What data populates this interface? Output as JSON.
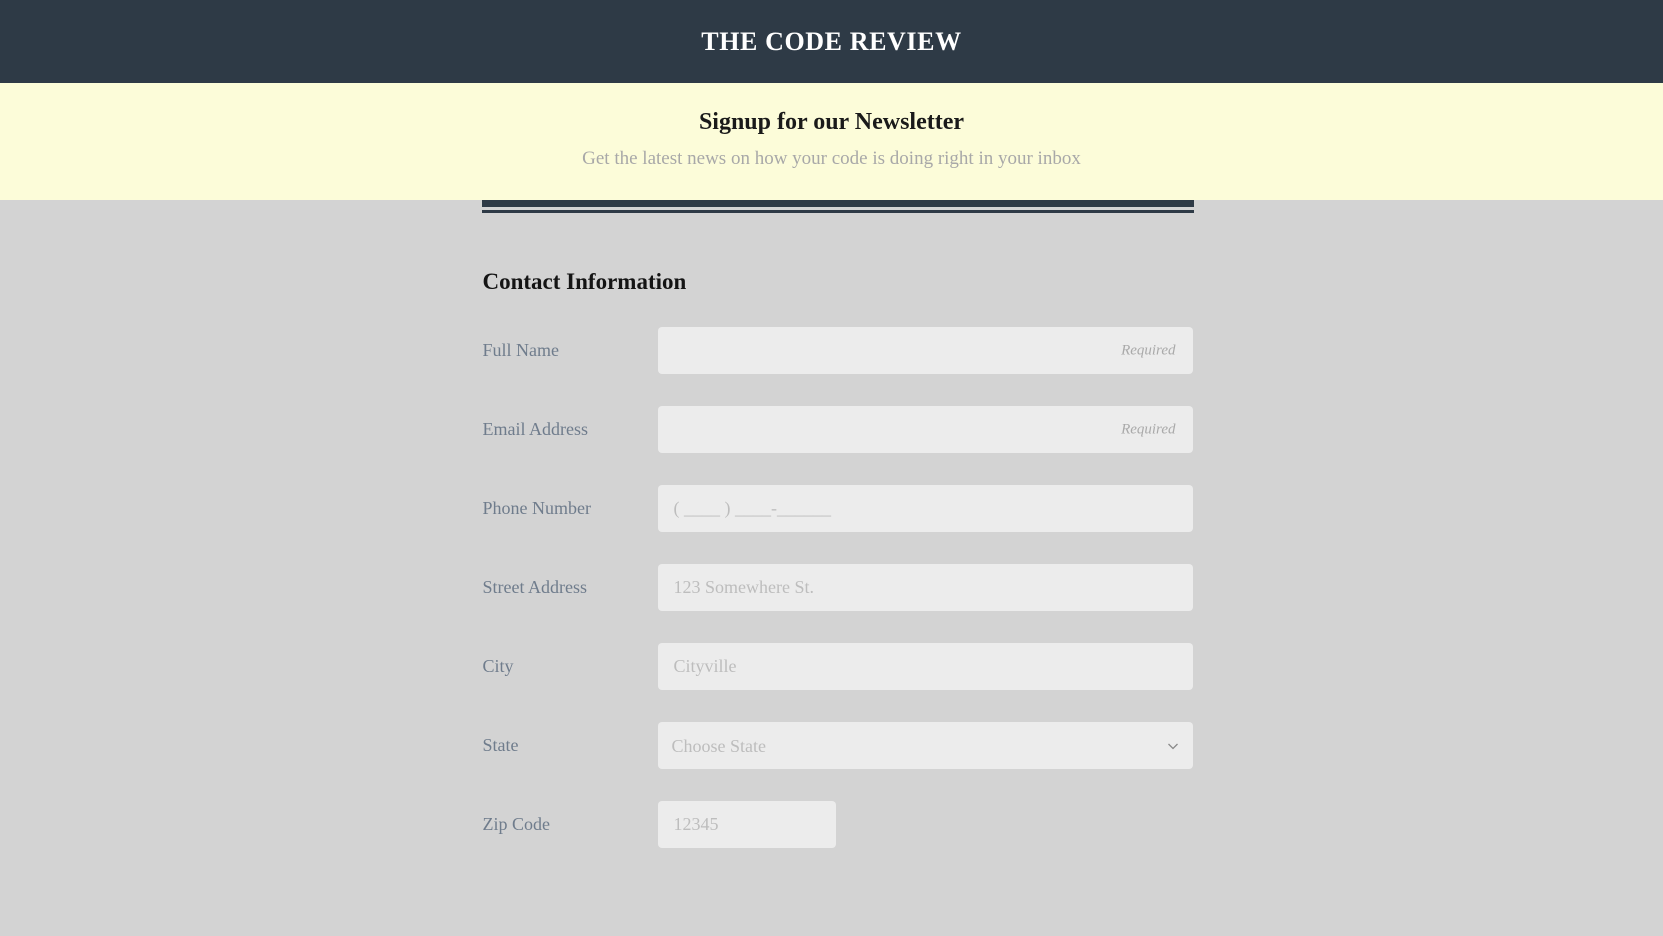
{
  "masthead": {
    "title": "THE CODE REVIEW"
  },
  "banner": {
    "title": "Signup for our Newsletter",
    "subtitle": "Get the latest news on how your code is doing right in your inbox"
  },
  "form": {
    "section_title": "Contact Information",
    "required_tag": "Required",
    "fields": [
      {
        "label": "Full Name",
        "type": "text",
        "value": "",
        "placeholder": "",
        "required_note": "Required"
      },
      {
        "label": "Email Address",
        "type": "email",
        "value": "",
        "placeholder": "",
        "required_note": "Required"
      },
      {
        "label": "Phone Number",
        "type": "tel",
        "value": "",
        "placeholder": "( ____ ) ____-______"
      },
      {
        "label": "Street Address",
        "type": "text",
        "value": "",
        "placeholder": "123 Somewhere St."
      },
      {
        "label": "City",
        "type": "text",
        "value": "",
        "placeholder": "Cityville"
      },
      {
        "label": "State",
        "type": "select",
        "value": "Choose State"
      },
      {
        "label": "Zip Code",
        "type": "text",
        "value": "",
        "placeholder": "12345"
      }
    ],
    "state_selected": "Choose State"
  },
  "colors": {
    "header_bg": "#2e3a46",
    "banner_bg": "#fcfcd9",
    "page_bg": "#d3d3d3",
    "input_bg": "#ececec",
    "label": "#6f7c8c",
    "placeholder": "#bdbdbd"
  },
  "icons": {
    "chevron_down": "chevron-down-icon"
  }
}
